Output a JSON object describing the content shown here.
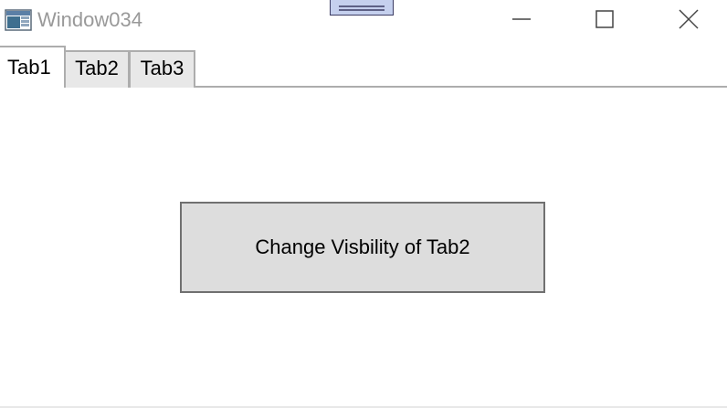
{
  "window": {
    "title": "Window034"
  },
  "titlebar": {
    "icons": {
      "app": "app-window-icon",
      "minimize": "minimize-icon",
      "maximize": "maximize-icon",
      "close": "close-icon"
    }
  },
  "tabs": [
    {
      "label": "Tab1",
      "selected": true
    },
    {
      "label": "Tab2",
      "selected": false
    },
    {
      "label": "Tab3",
      "selected": false
    }
  ],
  "content": {
    "button_label": "Change Visbility of Tab2"
  },
  "colors": {
    "title_text": "#999999",
    "tab_border": "#adadad",
    "tab_inactive_bg": "#e8e8e8",
    "button_bg": "#dddddd",
    "button_border": "#707070",
    "drag_handle_fill": "#c5d0ee",
    "drag_handle_border": "#3c3c64"
  }
}
